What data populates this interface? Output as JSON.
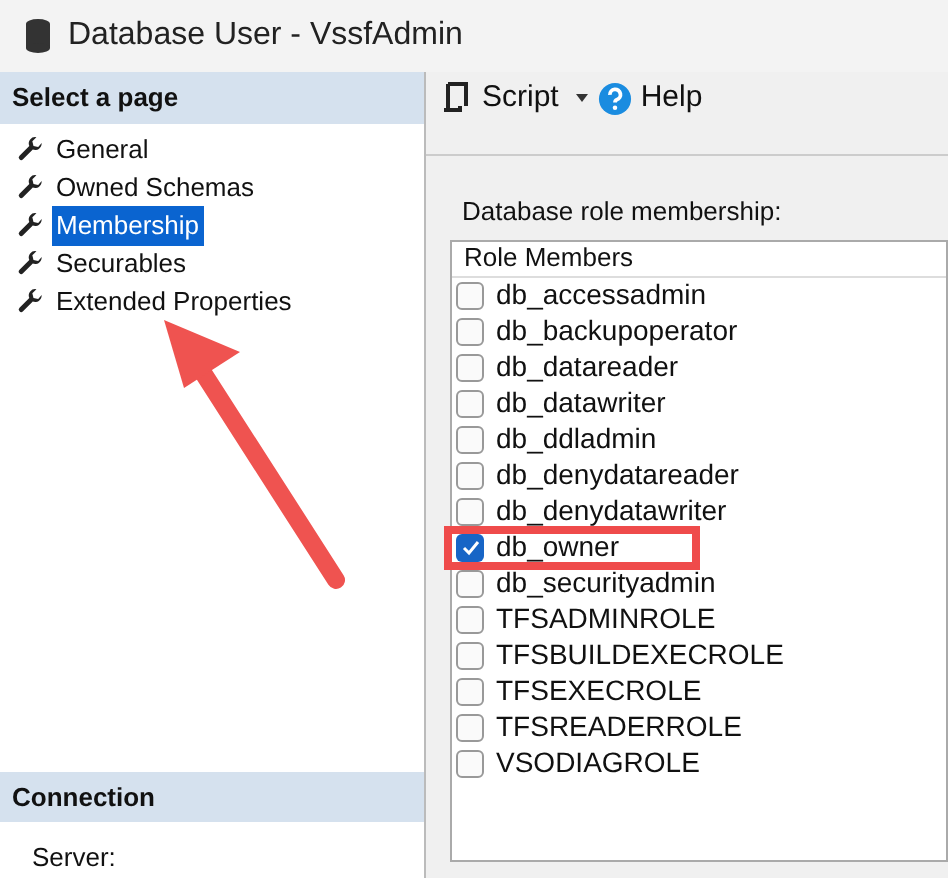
{
  "window": {
    "title": "Database User - VssfAdmin"
  },
  "sidebar": {
    "header": "Select a page",
    "items": [
      {
        "label": "General",
        "selected": false
      },
      {
        "label": "Owned Schemas",
        "selected": false
      },
      {
        "label": "Membership",
        "selected": true
      },
      {
        "label": "Securables",
        "selected": false
      },
      {
        "label": "Extended Properties",
        "selected": false
      }
    ]
  },
  "connection": {
    "header": "Connection",
    "server_label": "Server:"
  },
  "toolbar": {
    "script": "Script",
    "help": "Help"
  },
  "role_membership": {
    "label": "Database role membership:",
    "column": "Role Members",
    "rows": [
      {
        "name": "db_accessadmin",
        "checked": false,
        "highlighted": false
      },
      {
        "name": "db_backupoperator",
        "checked": false,
        "highlighted": false
      },
      {
        "name": "db_datareader",
        "checked": false,
        "highlighted": false
      },
      {
        "name": "db_datawriter",
        "checked": false,
        "highlighted": false
      },
      {
        "name": "db_ddladmin",
        "checked": false,
        "highlighted": false
      },
      {
        "name": "db_denydatareader",
        "checked": false,
        "highlighted": false
      },
      {
        "name": "db_denydatawriter",
        "checked": false,
        "highlighted": false
      },
      {
        "name": "db_owner",
        "checked": true,
        "highlighted": true
      },
      {
        "name": "db_securityadmin",
        "checked": false,
        "highlighted": false
      },
      {
        "name": "TFSADMINROLE",
        "checked": false,
        "highlighted": false
      },
      {
        "name": "TFSBUILDEXECROLE",
        "checked": false,
        "highlighted": false
      },
      {
        "name": "TFSEXECROLE",
        "checked": false,
        "highlighted": false
      },
      {
        "name": "TFSREADERROLE",
        "checked": false,
        "highlighted": false
      },
      {
        "name": "VSODIAGROLE",
        "checked": false,
        "highlighted": false
      }
    ]
  }
}
